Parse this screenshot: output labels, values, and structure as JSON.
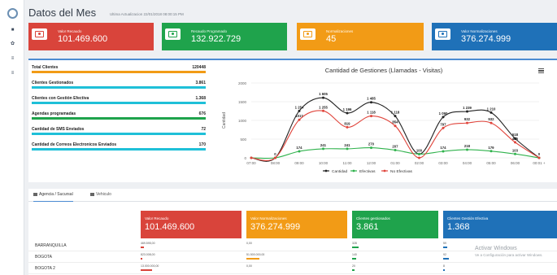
{
  "header": {
    "title": "Datos del Mes",
    "updated": "Ultima Actualizacion 22/01/2018 08:00:15 PM"
  },
  "colors": {
    "red": "#d9443b",
    "green": "#1fa34c",
    "orange": "#f29b16",
    "blue": "#1f71b8",
    "accent": "#4c8bd2"
  },
  "rail": {
    "items": [
      "dashboard-icon",
      "settings-icon",
      "list-icon",
      "filter-icon"
    ]
  },
  "cards": [
    {
      "label": "Valor Recaudo",
      "value": "101.469.600",
      "icon": "money-icon",
      "color": "#d9443b"
    },
    {
      "label": "Recaudo Programado",
      "value": "132.922.729",
      "icon": "money-icon",
      "color": "#1fa34c"
    },
    {
      "label": "Normalizaciones",
      "value": "45",
      "icon": "money-icon",
      "color": "#f29b16"
    },
    {
      "label": "Valor Normalizaciones",
      "value": "376.274.999",
      "icon": "money-icon",
      "color": "#1f71b8"
    }
  ],
  "stats": [
    {
      "label": "Total Clientes",
      "value": "120448",
      "fraction": 1.0,
      "color": "#f29b16"
    },
    {
      "label": "Clientes Gestionados",
      "value": "3.861",
      "fraction": 1.0,
      "color": "#1fc0d8"
    },
    {
      "label": "Clientes con Gestión Efectiva",
      "value": "1.368",
      "fraction": 1.0,
      "color": "#1fc0d8"
    },
    {
      "label": "Agendas programadas",
      "value": "676",
      "fraction": 1.0,
      "color": "#1fa34c"
    },
    {
      "label": "Cantidad de SMS Enviados",
      "value": "72",
      "fraction": 1.0,
      "color": "#1fc0d8"
    },
    {
      "label": "Cantidad de Correos Electronicos Enviados",
      "value": "170",
      "fraction": 1.0,
      "color": "#1fc0d8"
    }
  ],
  "chart_data": {
    "type": "line",
    "title": "Cantidad de Gestiones (Llamadas - Visitas)",
    "ylabel": "Cantidad",
    "xlabel": "",
    "ylim": [
      0,
      2000
    ],
    "yticks": [
      "2000",
      "1500",
      "1000",
      "500",
      "0"
    ],
    "categories": [
      "07:00",
      "08:00",
      "09:00",
      "10:00",
      "11:00",
      "12:00",
      "01:00",
      "02:00",
      "03:00",
      "04:00",
      "05:00",
      "06:00",
      "00:01 +"
    ],
    "legend_position": "bottom",
    "grid": true,
    "series": [
      {
        "name": "Cantidad",
        "color": "#222222",
        "values": [
          0,
          0,
          1254,
          1605,
          1196,
          1485,
          1118,
          100,
          1090,
          1239,
          1210,
          518,
          0
        ],
        "labels": [
          "",
          "0",
          "1 254",
          "1 605",
          "1 196",
          "1 485",
          "1 118",
          "100",
          "1 090",
          "1 239",
          "1 210",
          "518",
          "0"
        ]
      },
      {
        "name": "Efectivas",
        "color": "#2fb24c",
        "values": [
          0,
          0,
          174,
          241,
          241,
          270,
          207,
          100,
          174,
          218,
          179,
          103,
          0
        ],
        "labels": [
          "",
          "",
          "174",
          "241",
          "241",
          "270",
          "207",
          "",
          "174",
          "218",
          "179",
          "103",
          ""
        ]
      },
      {
        "name": "No Efectivas",
        "color": "#e0443b",
        "values": [
          0,
          0,
          1017,
          1255,
          819,
          1118,
          854,
          0,
          797,
          932,
          932,
          415,
          0
        ],
        "labels": [
          "",
          "",
          "1017",
          "1 255",
          "819",
          "1 118",
          "854",
          "",
          "797",
          "932",
          "932",
          "415",
          ""
        ]
      }
    ]
  },
  "bottom": {
    "tabs": [
      {
        "label": "Agencia / Sucursal",
        "active": true
      },
      {
        "label": "Vehiculo",
        "active": false
      }
    ],
    "cards": [
      {
        "label": "Valor Recaudo",
        "value": "101.469.600",
        "color": "#d9443b"
      },
      {
        "label": "Valor Normalizaciones",
        "value": "376.274.999",
        "color": "#f29b16"
      },
      {
        "label": "Clientes gestionados",
        "value": "3.861",
        "color": "#1fa34c"
      },
      {
        "label": "Clientes Gestión Efectiva",
        "value": "1.368",
        "color": "#1f71b8"
      }
    ],
    "rows": [
      {
        "name": "BARRANQUILLA",
        "recaudo": "469.595,00",
        "normalizaciones": "0,00",
        "gestionados": "328",
        "efectiva": "59"
      },
      {
        "name": "BOGOTA",
        "recaudo": "823.008,00",
        "normalizaciones": "51.500.000,00",
        "gestionados": "140",
        "efectiva": "92"
      },
      {
        "name": "BOGOTA 2",
        "recaudo": "13.000.000,00",
        "normalizaciones": "0,00",
        "gestionados": "20",
        "efectiva": "8"
      }
    ]
  },
  "watermark": {
    "line1": "Activar Windows",
    "line2": "Ve a Configuración para activar Windows."
  }
}
